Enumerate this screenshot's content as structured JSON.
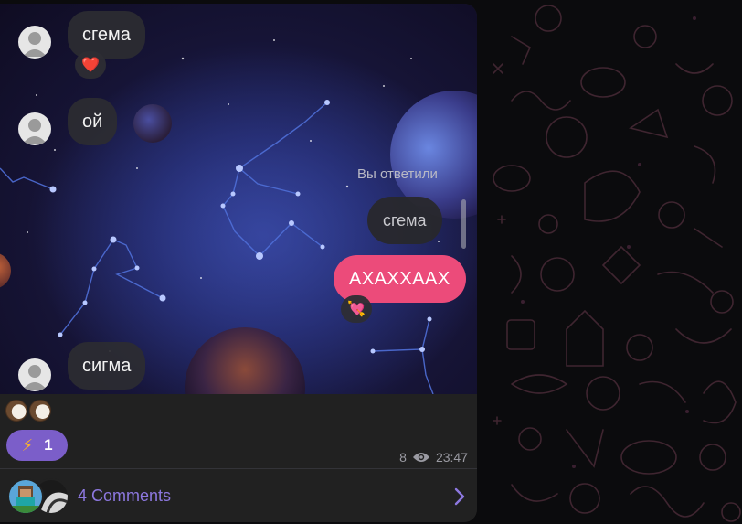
{
  "messages": {
    "m1": {
      "text": "сгема",
      "reaction": "❤️"
    },
    "m2": {
      "text": "ой"
    },
    "reply_label": "Вы ответили",
    "reply_quote": "сгема",
    "m3": {
      "text": "АХАХХААХ",
      "reaction": "💘"
    },
    "m4": {
      "text": "сигма"
    }
  },
  "footer": {
    "emoji_icon": "coconut-icon",
    "reaction_count": "1",
    "reaction_icon": "lightning-icon",
    "views": "8",
    "time": "23:47",
    "comments_label": "4 Comments"
  },
  "colors": {
    "accent": "#8d78e0",
    "reaction_pill": "#7b5ec9",
    "outgoing_bubble": "#ec4b7a",
    "card_bg": "#212121"
  }
}
